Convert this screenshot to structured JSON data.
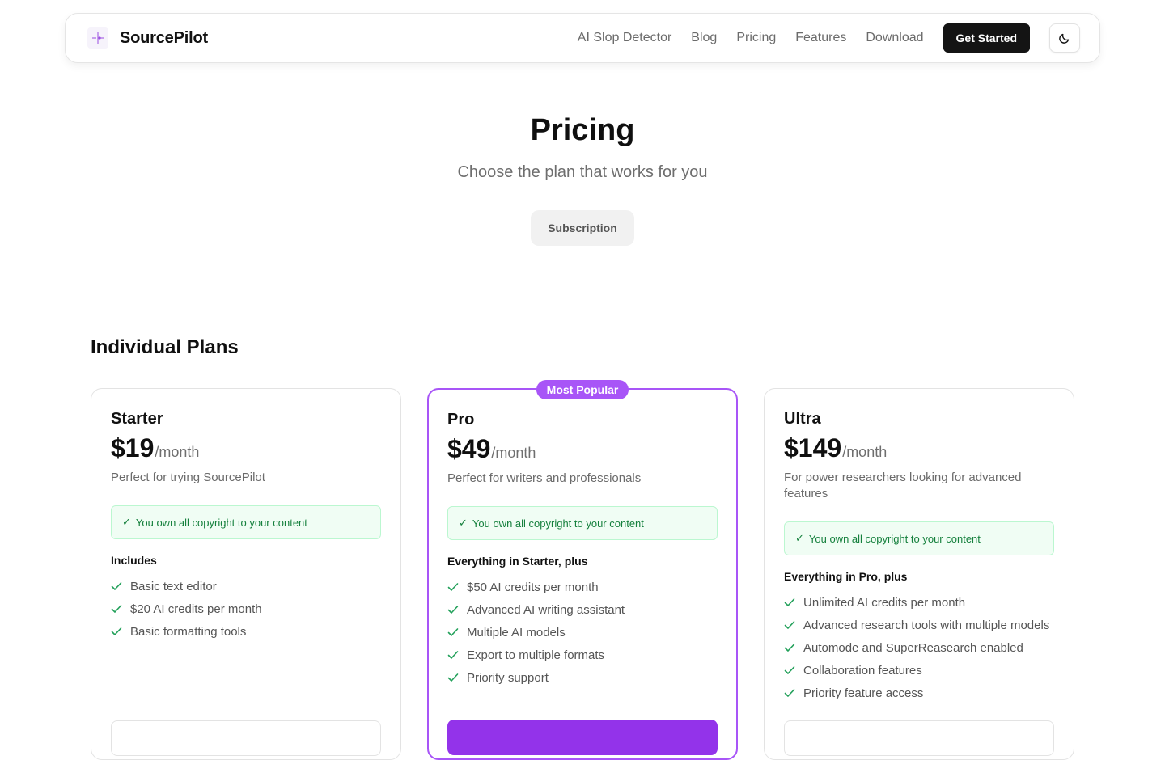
{
  "nav": {
    "brand": "SourcePilot",
    "links": [
      "AI Slop Detector",
      "Blog",
      "Pricing",
      "Features",
      "Download"
    ],
    "cta": "Get Started",
    "icons": {
      "logo": "sparkle-logo-icon",
      "theme": "moon-icon"
    }
  },
  "hero": {
    "title": "Pricing",
    "subtitle": "Choose the plan that works for you",
    "toggle_label": "Subscription"
  },
  "section": {
    "title": "Individual Plans"
  },
  "plans": [
    {
      "name": "Starter",
      "price": "$19",
      "period": "/month",
      "description": "Perfect for trying SourcePilot",
      "copyright": "You own all copyright to your content",
      "includes_title": "Includes",
      "features": [
        "Basic text editor",
        "$20 AI credits per month",
        "Basic formatting tools"
      ]
    },
    {
      "name": "Pro",
      "badge": "Most Popular",
      "price": "$49",
      "period": "/month",
      "description": "Perfect for writers and professionals",
      "copyright": "You own all copyright to your content",
      "includes_title": "Everything in Starter, plus",
      "features": [
        "$50 AI credits per month",
        "Advanced AI writing assistant",
        "Multiple AI models",
        "Export to multiple formats",
        "Priority support"
      ]
    },
    {
      "name": "Ultra",
      "price": "$149",
      "period": "/month",
      "description": "For power researchers looking for advanced features",
      "copyright": "You own all copyright to your content",
      "includes_title": "Everything in Pro, plus",
      "features": [
        "Unlimited AI credits per month",
        "Advanced research tools with multiple models",
        "Automode and SuperReasearch enabled",
        "Collaboration features",
        "Priority feature access"
      ]
    }
  ],
  "colors": {
    "accent": "#a855f7",
    "check": "#22a05a",
    "copyright_bg": "#f0fdf4",
    "copyright_text": "#15803d"
  }
}
